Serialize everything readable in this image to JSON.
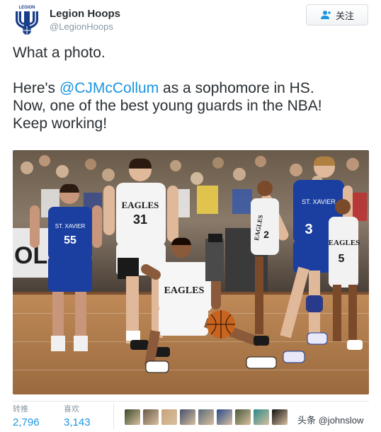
{
  "account": {
    "name": "Legion Hoops",
    "handle": "@LegionHoops",
    "logo_text": "LEGION",
    "avatar_icon": "legion-hoops-logo-icon"
  },
  "follow_button": {
    "label": "关注",
    "icon": "add-user-icon"
  },
  "tweet": {
    "line1": "What a photo.",
    "line2_prefix": "Here's ",
    "mention": "@CJMcCollum",
    "line2_suffix": " as a sophomore in HS.",
    "line3": "Now, one of the best young guards in the NBA!",
    "line4": "Keep working!"
  },
  "photo": {
    "description_icon": "basketball-game-photo",
    "jersey_text": {
      "left_player": "ST. XAVIER",
      "left_number": "55",
      "center_back": "EAGLES",
      "center_back_number": "31",
      "dribbler": "EAGLES",
      "right_player": "ST. XAVIER",
      "right_number": "3",
      "bg_player_a": "EAGLES",
      "bg_player_a_number": "2",
      "bg_player_b": "EAGLES",
      "bg_player_b_number": "5"
    }
  },
  "stats": {
    "retweets_label": "转推",
    "retweets_value": "2,796",
    "likes_label": "喜欢",
    "likes_value": "3,143"
  },
  "liker_faces": [
    {
      "name": "liker-1",
      "color": "#3a4a2a"
    },
    {
      "name": "liker-2",
      "color": "#6b5a4a"
    },
    {
      "name": "liker-3",
      "color": "#c9a37a"
    },
    {
      "name": "liker-4",
      "color": "#44506a"
    },
    {
      "name": "liker-5",
      "color": "#5a6a7a"
    },
    {
      "name": "liker-6",
      "color": "#2a4a8a"
    },
    {
      "name": "liker-7",
      "color": "#4a5a3a"
    },
    {
      "name": "liker-8",
      "color": "#2a8a8a"
    },
    {
      "name": "liker-9",
      "color": "#111111"
    }
  ],
  "watermark": "头条 @johnslow",
  "colors": {
    "link_blue": "#1b95e0",
    "text": "#292f33",
    "muted": "#8899a6",
    "jersey_blue": "#1a3fa0",
    "floor": "#b07a4a"
  }
}
